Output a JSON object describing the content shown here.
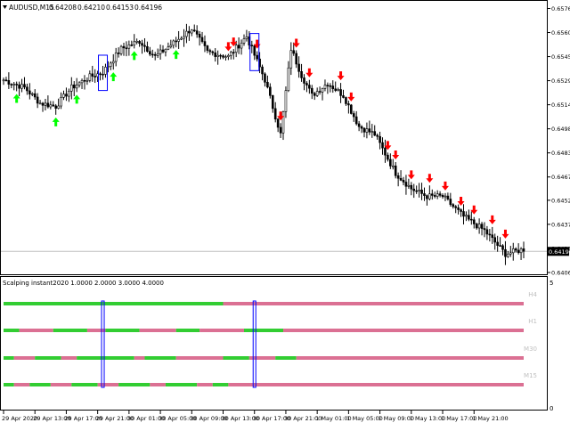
{
  "chart_data": [
    {
      "type": "candlestick",
      "header": {
        "symbol": "AUDUSD,M15",
        "open": "0.64208",
        "high": "0.64210",
        "low": "0.64153",
        "close": "0.64196"
      },
      "current_price_label": "0.64196",
      "ylim": [
        0.6406,
        0.6578
      ],
      "y_ticks": [
        "0.65760",
        "0.65605",
        "0.65450",
        "0.65295",
        "0.65140",
        "0.64985",
        "0.64830",
        "0.64675",
        "0.64525",
        "0.64370",
        "0.64215",
        "0.64060"
      ],
      "y_tick_values": [
        0.6576,
        0.65605,
        0.6545,
        0.65295,
        0.6514,
        0.64985,
        0.6483,
        0.64675,
        0.64525,
        0.6437,
        0.64215,
        0.6406
      ],
      "bar_count": 200,
      "price_path": {
        "bar_index": [
          0,
          8,
          14,
          20,
          26,
          33,
          38,
          45,
          52,
          58,
          66,
          72,
          78,
          86,
          93,
          100,
          106,
          110,
          114,
          118,
          124,
          130,
          136,
          142,
          150,
          156,
          162,
          168,
          176,
          184,
          192,
          199
        ],
        "close": [
          0.653,
          0.6525,
          0.6515,
          0.6513,
          0.6525,
          0.6532,
          0.6535,
          0.655,
          0.6555,
          0.6545,
          0.6555,
          0.6563,
          0.6548,
          0.6545,
          0.6558,
          0.653,
          0.6495,
          0.655,
          0.6533,
          0.652,
          0.6528,
          0.652,
          0.65,
          0.6495,
          0.647,
          0.646,
          0.6455,
          0.6455,
          0.6442,
          0.6433,
          0.6418,
          0.6421
        ]
      },
      "buy_arrow_bars": [
        5,
        20,
        28,
        42,
        50,
        66
      ],
      "sell_arrow_bars": [
        86,
        88,
        97,
        106,
        112,
        117,
        129,
        133,
        147,
        150,
        156,
        163,
        169,
        175,
        180,
        187,
        192
      ],
      "highlight_box_bars": [
        38,
        96
      ],
      "colors": {
        "buy": "#00ff00",
        "sell": "#ff0000",
        "box": "#0000ff",
        "candle": "#000000"
      }
    },
    {
      "type": "heatmap",
      "title": "Scalping instant2020 1.0000 2.0000 3.0000 4.0000",
      "y_axis_top_label": "5",
      "y_axis_bottom_label": "0",
      "rows": [
        {
          "name": "H4",
          "segments": [
            [
              0,
              84,
              "green"
            ],
            [
              84,
              200,
              "pink"
            ]
          ]
        },
        {
          "name": "H1",
          "segments": [
            [
              0,
              6,
              "green"
            ],
            [
              6,
              19,
              "pink"
            ],
            [
              19,
              32,
              "green"
            ],
            [
              32,
              39,
              "pink"
            ],
            [
              39,
              52,
              "green"
            ],
            [
              52,
              66,
              "pink"
            ],
            [
              66,
              75,
              "green"
            ],
            [
              75,
              92,
              "pink"
            ],
            [
              92,
              107,
              "green"
            ],
            [
              107,
              200,
              "pink"
            ]
          ]
        },
        {
          "name": "M30",
          "segments": [
            [
              0,
              4,
              "green"
            ],
            [
              4,
              12,
              "pink"
            ],
            [
              12,
              22,
              "green"
            ],
            [
              22,
              28,
              "pink"
            ],
            [
              28,
              50,
              "green"
            ],
            [
              50,
              54,
              "pink"
            ],
            [
              54,
              66,
              "green"
            ],
            [
              66,
              84,
              "pink"
            ],
            [
              84,
              94,
              "green"
            ],
            [
              94,
              104,
              "pink"
            ],
            [
              104,
              112,
              "green"
            ],
            [
              112,
              200,
              "pink"
            ]
          ]
        },
        {
          "name": "M15",
          "segments": [
            [
              0,
              4,
              "green"
            ],
            [
              4,
              10,
              "pink"
            ],
            [
              10,
              18,
              "green"
            ],
            [
              18,
              26,
              "pink"
            ],
            [
              26,
              36,
              "green"
            ],
            [
              36,
              44,
              "pink"
            ],
            [
              44,
              56,
              "green"
            ],
            [
              56,
              62,
              "pink"
            ],
            [
              62,
              74,
              "green"
            ],
            [
              74,
              80,
              "pink"
            ],
            [
              80,
              86,
              "green"
            ],
            [
              86,
              200,
              "pink"
            ]
          ]
        }
      ],
      "colors": {
        "green": "#32cd32",
        "pink": "#db7093",
        "box": "#0000ff"
      },
      "highlight_box_bars": [
        38,
        96
      ]
    }
  ],
  "x_axis": {
    "labels": [
      "29 Apr 2020",
      "29 Apr 13:00",
      "29 Apr 17:00",
      "29 Apr 21:00",
      "30 Apr 01:00",
      "30 Apr 05:00",
      "30 Apr 09:00",
      "30 Apr 13:00",
      "30 Apr 17:00",
      "30 Apr 21:00",
      "1 May 01:00",
      "1 May 05:00",
      "1 May 09:00",
      "1 May 13:00",
      "1 May 17:00",
      "1 May 21:00"
    ],
    "label_bars": [
      0,
      12,
      24,
      36,
      48,
      60,
      72,
      84,
      96,
      108,
      120,
      132,
      144,
      156,
      168,
      180
    ]
  }
}
